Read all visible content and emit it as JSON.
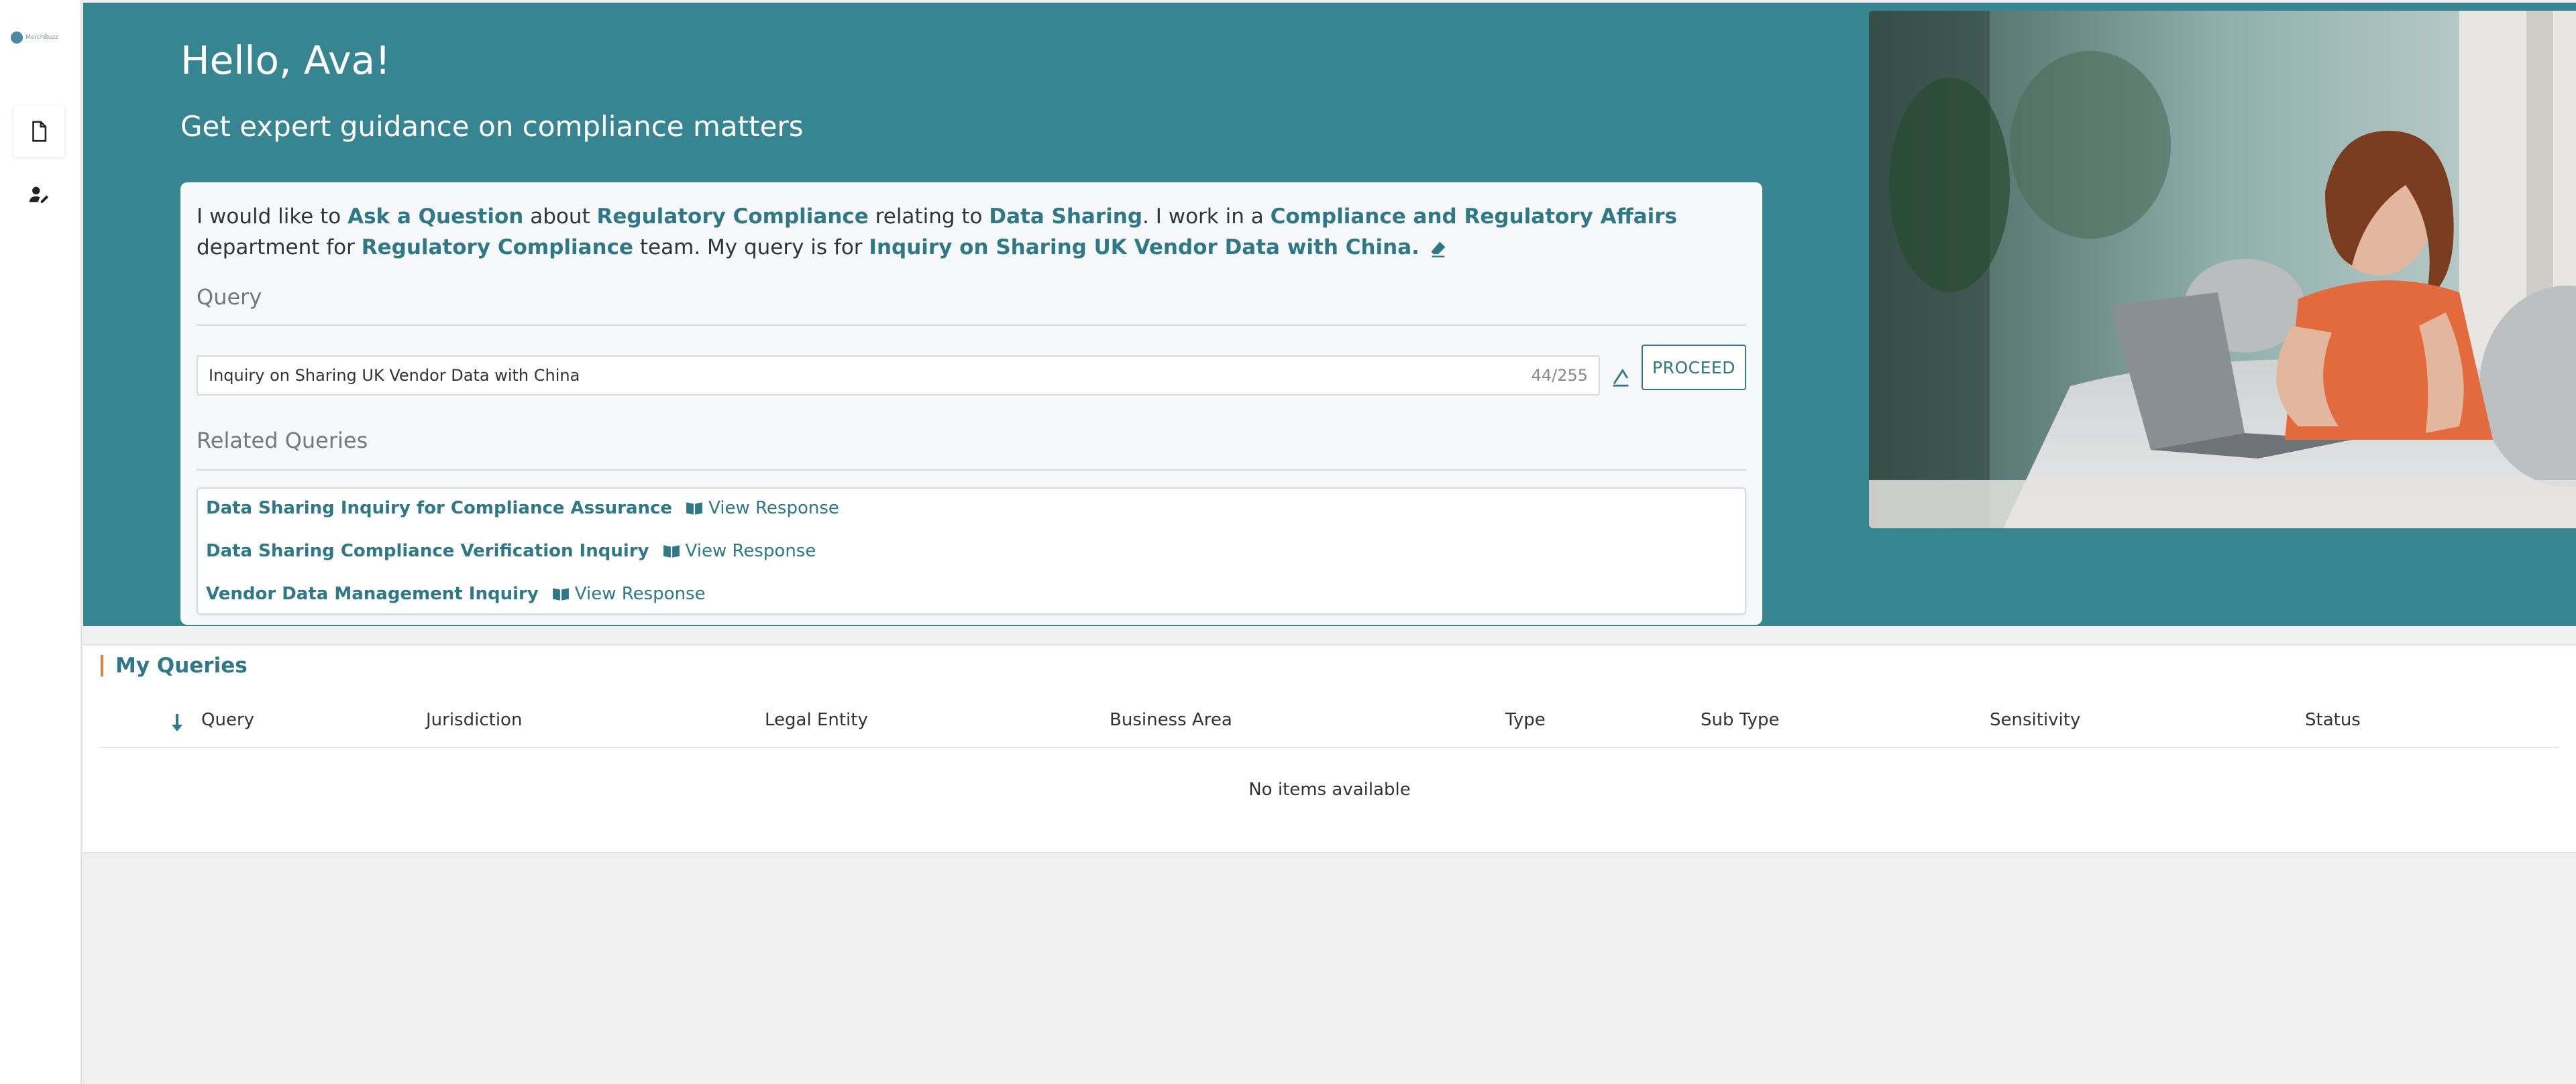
{
  "sidebar": {
    "logo_text": "MerchBuzz",
    "items": [
      {
        "name": "documents",
        "icon": "document-icon"
      },
      {
        "name": "user-manage",
        "icon": "user-edit-icon"
      }
    ]
  },
  "hero": {
    "greeting": "Hello, Ava!",
    "subtitle": "Get expert guidance on compliance matters",
    "sentence": {
      "t1": "I would like to ",
      "action": "Ask a Question",
      "t2": " about ",
      "topic": "Regulatory Compliance",
      "t3": " relating to ",
      "subtopic": "Data Sharing",
      "t4": ". I work in a ",
      "department": "Compliance and Regulatory Affairs",
      "t5": " department for ",
      "team": "Regulatory Compliance",
      "t6": " team. My query is for ",
      "query": "Inquiry on Sharing UK Vendor Data with China."
    },
    "query_label": "Query",
    "query_value": "Inquiry on Sharing UK Vendor Data with China",
    "query_counter": "44/255",
    "proceed_label": "PROCEED",
    "related_label": "Related Queries",
    "related": [
      {
        "title": "Data Sharing Inquiry for Compliance Assurance",
        "link": "View Response"
      },
      {
        "title": "Data Sharing Compliance Verification Inquiry",
        "link": "View Response"
      },
      {
        "title": "Vendor Data Management Inquiry",
        "link": "View Response"
      }
    ]
  },
  "my_queries": {
    "title": "My Queries",
    "columns": [
      "Query",
      "Jurisdiction",
      "Legal Entity",
      "Business Area",
      "Type",
      "Sub Type",
      "Sensitivity",
      "Status"
    ],
    "empty_text": "No items available"
  },
  "colors": {
    "hero_bg": "#368591",
    "accent": "#2f7886",
    "title_bar": "#e87c3e"
  }
}
